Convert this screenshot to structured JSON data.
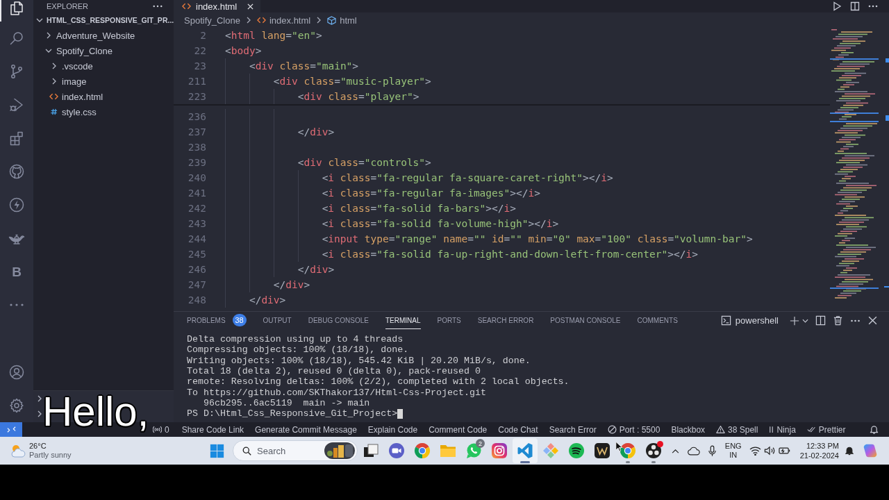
{
  "activity_bar": {
    "items": [
      {
        "kind": "explorer",
        "selected": true
      },
      {
        "kind": "search",
        "selected": false
      },
      {
        "kind": "source-control",
        "selected": false
      },
      {
        "kind": "run-debug",
        "selected": false
      },
      {
        "kind": "extensions",
        "selected": false
      },
      {
        "kind": "cat-logo",
        "selected": false
      },
      {
        "kind": "lightning",
        "selected": false
      },
      {
        "kind": "lamp",
        "selected": false
      },
      {
        "kind": "letter",
        "label": "B",
        "selected": false
      },
      {
        "kind": "more",
        "selected": false
      }
    ],
    "bottom": [
      {
        "kind": "account"
      },
      {
        "kind": "settings"
      }
    ]
  },
  "sidebar": {
    "title": "EXPLORER",
    "folder": {
      "name": "HTML_CSS_RESPONSIVE_GIT_PR...",
      "expanded": true,
      "children": [
        {
          "name": "Adventure_Website",
          "kind": "folder",
          "expanded": false,
          "selected": false
        },
        {
          "name": "Spotify_Clone",
          "kind": "folder",
          "expanded": true,
          "selected": false,
          "children": [
            {
              "name": ".vscode",
              "kind": "folder",
              "expanded": false,
              "selected": false
            },
            {
              "name": "image",
              "kind": "folder",
              "expanded": false,
              "selected": false
            },
            {
              "name": "index.html",
              "kind": "html",
              "selected": false
            },
            {
              "name": "style.css",
              "kind": "css",
              "selected": false
            }
          ]
        }
      ]
    },
    "sections": [
      {
        "expanded": false
      },
      {
        "expanded": false
      }
    ]
  },
  "editor": {
    "tabs": [
      {
        "label": "index.html",
        "kind": "html",
        "selected": true
      }
    ],
    "breadcrumbs": [
      {
        "label": "Spotify_Clone",
        "kind": "folder"
      },
      {
        "label": "index.html",
        "kind": "html"
      },
      {
        "label": "html",
        "kind": "element"
      }
    ],
    "sticky_lines": [
      {
        "number": "2",
        "code": "<html lang=\"en\">"
      },
      {
        "number": "22",
        "code": "<body>"
      },
      {
        "number": "23",
        "code": "    <div class=\"main\">"
      },
      {
        "number": "211",
        "code": "        <div class=\"music-player\">"
      },
      {
        "number": "223",
        "code": "            <div class=\"player\">"
      }
    ],
    "lines": [
      {
        "number": "236"
      },
      {
        "number": "237",
        "code": "            </div>"
      },
      {
        "number": "238"
      },
      {
        "number": "239",
        "code": "            <div class=\"controls\">"
      },
      {
        "number": "240",
        "code": "                <i class=\"fa-regular fa-square-caret-right\"></i>"
      },
      {
        "number": "241",
        "code": "                <i class=\"fa-regular fa-images\"></i>"
      },
      {
        "number": "242",
        "code": "                <i class=\"fa-solid fa-bars\"></i>"
      },
      {
        "number": "243",
        "code": "                <i class=\"fa-solid fa-volume-high\"></i>"
      },
      {
        "number": "244",
        "code": "                <input type=\"range\" name=\"\" id=\"\" min=\"0\" max=\"100\" class=\"volumn-bar\">"
      },
      {
        "number": "245",
        "code": "                <i class=\"fa-solid fa-up-right-and-down-left-from-center\"></i>"
      },
      {
        "number": "246",
        "code": "            </div>"
      },
      {
        "number": "247",
        "code": "        </div>"
      },
      {
        "number": "248",
        "code": "    </div>"
      }
    ]
  },
  "panel": {
    "tabs": [
      {
        "label": "PROBLEMS",
        "badge": "38",
        "selected": false
      },
      {
        "label": "OUTPUT",
        "selected": false
      },
      {
        "label": "DEBUG CONSOLE",
        "selected": false
      },
      {
        "label": "TERMINAL",
        "selected": true
      },
      {
        "label": "PORTS",
        "selected": false
      },
      {
        "label": "SEARCH ERROR",
        "selected": false
      },
      {
        "label": "POSTMAN CONSOLE",
        "selected": false
      },
      {
        "label": "COMMENTS",
        "selected": false
      }
    ],
    "terminal_name": "powershell",
    "terminal_lines": [
      "Delta compression using up to 4 threads",
      "Compressing objects: 100% (18/18), done.",
      "Writing objects: 100% (18/18), 545.42 KiB | 20.20 MiB/s, done.",
      "Total 18 (delta 2), reused 0 (delta 0), pack-reused 0",
      "remote: Resolving deltas: 100% (2/2), completed with 2 local objects.",
      "To https://github.com/SKThakor137/Html-Css-Project.git",
      "   96cb295..6ac5119  main -> main"
    ],
    "prompt": "PS D:\\Html_Css_Responsive_Git_Project>"
  },
  "status_bar": {
    "left": [
      {
        "kind": "remote"
      },
      {
        "kind": "ports",
        "label": "0"
      },
      {
        "kind": "text",
        "label": "Share Code Link"
      },
      {
        "kind": "text",
        "label": "Generate Commit Message"
      },
      {
        "kind": "text",
        "label": "Explain Code"
      },
      {
        "kind": "text",
        "label": "Comment Code"
      },
      {
        "kind": "text",
        "label": "Code Chat"
      },
      {
        "kind": "text",
        "label": "Search Error"
      }
    ],
    "right": [
      {
        "kind": "port",
        "label": "Port : 5500"
      },
      {
        "kind": "text",
        "label": "Blackbox"
      },
      {
        "kind": "warning",
        "label": "38 Spell"
      },
      {
        "kind": "pause",
        "label": "Ninja"
      },
      {
        "kind": "double-check",
        "label": "Prettier"
      },
      {
        "kind": "bell"
      }
    ]
  },
  "taskbar": {
    "weather": {
      "temperature": "26°C",
      "condition": "Partly sunny"
    },
    "search": {
      "placeholder": "Search"
    },
    "apps": [
      {
        "kind": "squares",
        "running": false,
        "active": false
      },
      {
        "kind": "video",
        "running": false,
        "active": false
      },
      {
        "kind": "tricolor",
        "running": false,
        "active": false
      },
      {
        "kind": "folder",
        "running": false,
        "active": false
      },
      {
        "kind": "chat",
        "badge": "2",
        "running": false,
        "active": false
      },
      {
        "kind": "camera",
        "running": false,
        "active": false
      },
      {
        "kind": "ribbon",
        "running": true,
        "active": true
      },
      {
        "kind": "diamond",
        "running": false,
        "active": false
      },
      {
        "kind": "waves",
        "running": false,
        "active": false
      },
      {
        "kind": "zigzag",
        "running": false,
        "active": false
      },
      {
        "kind": "tricolor",
        "running": true,
        "active": false
      },
      {
        "kind": "dots",
        "dot": true,
        "running": true,
        "active": false
      }
    ],
    "tray": {
      "language": "ENG",
      "region": "IN",
      "time": "12:33 PM",
      "date": "21-02-2024"
    }
  },
  "caption": "Hello,"
}
